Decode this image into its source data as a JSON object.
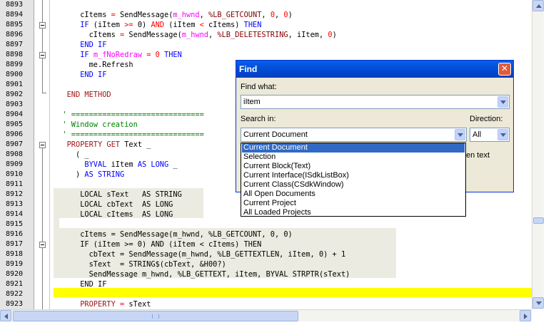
{
  "editor": {
    "lines": [
      {
        "n": "8893",
        "code": []
      },
      {
        "n": "8894",
        "code": [
          [
            "      cItems ",
            ""
          ],
          [
            "=",
            "op"
          ],
          [
            " SendMessage(",
            ""
          ],
          [
            "m_hwnd",
            "mag"
          ],
          [
            ", ",
            ""
          ],
          [
            "%LB_GETCOUNT",
            "con"
          ],
          [
            ", ",
            ""
          ],
          [
            "0",
            "num"
          ],
          [
            ", ",
            ""
          ],
          [
            "0",
            "num"
          ],
          [
            ")",
            ""
          ]
        ]
      },
      {
        "n": "8895",
        "code": [
          [
            "      ",
            ""
          ],
          [
            "IF",
            "kw"
          ],
          [
            " (iItem ",
            ""
          ],
          [
            ">=",
            "op"
          ],
          [
            " 0) ",
            ""
          ],
          [
            "AND",
            "op"
          ],
          [
            " (iItem ",
            ""
          ],
          [
            "<",
            "op"
          ],
          [
            " cItems) ",
            ""
          ],
          [
            "THEN",
            "kw"
          ]
        ]
      },
      {
        "n": "8896",
        "code": [
          [
            "        cItems ",
            ""
          ],
          [
            "=",
            "op"
          ],
          [
            " SendMessage(",
            ""
          ],
          [
            "m_hwnd",
            "mag"
          ],
          [
            ", ",
            ""
          ],
          [
            "%LB_DELETESTRING",
            "con"
          ],
          [
            ", iItem, ",
            ""
          ],
          [
            "0",
            "num"
          ],
          [
            ")",
            ""
          ]
        ]
      },
      {
        "n": "8897",
        "code": [
          [
            "      ",
            ""
          ],
          [
            "END IF",
            "kw"
          ]
        ]
      },
      {
        "n": "8898",
        "code": [
          [
            "      ",
            ""
          ],
          [
            "IF",
            "kw"
          ],
          [
            " ",
            ""
          ],
          [
            "m_fNoRedraw",
            "mag"
          ],
          [
            " ",
            ""
          ],
          [
            "=",
            "op"
          ],
          [
            " ",
            ""
          ],
          [
            "0",
            "num"
          ],
          [
            " ",
            ""
          ],
          [
            "THEN",
            "kw"
          ]
        ]
      },
      {
        "n": "8899",
        "code": [
          [
            "        me.Refresh",
            ""
          ]
        ]
      },
      {
        "n": "8900",
        "code": [
          [
            "      ",
            ""
          ],
          [
            "END IF",
            "kw"
          ]
        ]
      },
      {
        "n": "8901",
        "code": []
      },
      {
        "n": "8902",
        "code": [
          [
            "   ",
            ""
          ],
          [
            "END METHOD",
            "str"
          ]
        ]
      },
      {
        "n": "8903",
        "code": []
      },
      {
        "n": "8904",
        "code": [
          [
            "  ' ==============================",
            "cmt"
          ]
        ]
      },
      {
        "n": "8905",
        "code": [
          [
            "  ' Window creation",
            "cmt"
          ]
        ]
      },
      {
        "n": "8906",
        "code": [
          [
            "  ' ==============================",
            "cmt"
          ]
        ]
      },
      {
        "n": "8907",
        "code": [
          [
            "   ",
            ""
          ],
          [
            "PROPERTY GET",
            "str"
          ],
          [
            " Text _",
            ""
          ]
        ]
      },
      {
        "n": "8908",
        "code": [
          [
            "     ( _",
            ""
          ]
        ]
      },
      {
        "n": "8909",
        "code": [
          [
            "       ",
            ""
          ],
          [
            "BYVAL",
            "kw"
          ],
          [
            " iItem ",
            ""
          ],
          [
            "AS LONG",
            "kw"
          ],
          [
            " _",
            ""
          ]
        ]
      },
      {
        "n": "8910",
        "code": [
          [
            "     ) ",
            ""
          ],
          [
            "AS STRING",
            "kw"
          ]
        ]
      },
      {
        "n": "8911",
        "code": []
      },
      {
        "n": "8912",
        "code": [
          [
            "      LOCAL sText   AS STRING",
            ""
          ]
        ]
      },
      {
        "n": "8913",
        "code": [
          [
            "      LOCAL cbText  AS LONG",
            ""
          ]
        ]
      },
      {
        "n": "8914",
        "code": [
          [
            "      LOCAL cItems  AS LONG",
            ""
          ]
        ]
      },
      {
        "n": "8915",
        "code": []
      },
      {
        "n": "8916",
        "code": [
          [
            "      cItems = SendMessage(m_hwnd, %LB_GETCOUNT, 0, 0)",
            ""
          ]
        ]
      },
      {
        "n": "8917",
        "code": [
          [
            "      IF (iItem >= 0) AND (iItem < cItems) THEN",
            ""
          ]
        ]
      },
      {
        "n": "8918",
        "code": [
          [
            "        cbText = SendMessage(m_hwnd, %LB_GETTEXTLEN, iItem, 0) + 1",
            ""
          ]
        ]
      },
      {
        "n": "8919",
        "code": [
          [
            "        sText  = STRING$(cbText, &H00?)",
            ""
          ]
        ]
      },
      {
        "n": "8920",
        "code": [
          [
            "        SendMessage m_hwnd, %LB_GETTEXT, iItem, BYVAL STRPTR(sText)",
            ""
          ]
        ]
      },
      {
        "n": "8921",
        "code": [
          [
            "      END IF",
            ""
          ]
        ]
      },
      {
        "n": "8922",
        "code": []
      },
      {
        "n": "8923",
        "code": [
          [
            "      ",
            ""
          ],
          [
            "PROPERTY",
            "str"
          ],
          [
            " ",
            ""
          ],
          [
            "=",
            "op"
          ],
          [
            " sText",
            ""
          ]
        ]
      }
    ]
  },
  "find_dialog": {
    "title": "Find",
    "close_glyph": "✕",
    "find_what_label": "Find what:",
    "find_what_value": "iItem",
    "search_in_label": "Search in:",
    "search_in_value": "Current Document",
    "direction_label": "Direction:",
    "direction_value": "All",
    "partial_option_text": "en text",
    "search_in_options": [
      "Current Document",
      "Selection",
      "Current Block(Text)",
      "Current Interface(ISdkListBox)",
      "Current Class(CSdkWindow)",
      "All Open Documents",
      "Current Project",
      "All Loaded Projects"
    ],
    "selected_index": 0
  },
  "colors": {
    "selection": "#316ac5",
    "current_line": "#ffff00",
    "titlebar": "#0149d1"
  }
}
